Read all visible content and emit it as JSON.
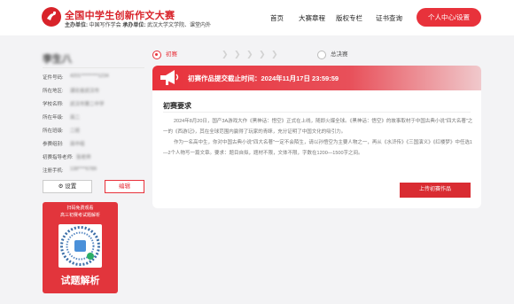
{
  "header": {
    "title": "全国中学生创新作文大赛",
    "sub_host_label": "主办单位:",
    "sub_host": "中国写作学会",
    "sub_org_label": "承办单位:",
    "sub_org": "武汉大学文学院、课堂内外",
    "nav": [
      "首页",
      "大赛章程",
      "版权专栏",
      "证书查询"
    ],
    "user_button": "个人中心/设置"
  },
  "profile": {
    "name": "李生八",
    "fields": [
      {
        "label": "证件号码:",
        "value": "4201*********1234"
      },
      {
        "label": "所在地区:",
        "value": "湖北省武汉市"
      },
      {
        "label": "学校名称:",
        "value": "武汉市第二中学"
      },
      {
        "label": "所在年级:",
        "value": "高二"
      },
      {
        "label": "所在班级:",
        "value": "二班"
      },
      {
        "label": "参赛组别:",
        "value": "高中组"
      },
      {
        "label": "初赛指导老师:",
        "value": "张老师"
      },
      {
        "label": "注册手机:",
        "value": "138****6789"
      }
    ],
    "settings_button": "⚙ 设置",
    "edit_button": "编辑"
  },
  "promo": {
    "line1": "扫码免费观看",
    "line2": "高三初赛考试题解析",
    "bottom": "试题解析"
  },
  "progress": {
    "step1": "初赛",
    "step2": "总决赛"
  },
  "main": {
    "deadline": "初赛作品提交截止时间：2024年11月17日 23:59:59",
    "req_title": "初赛要求",
    "para1": "2024年8月20日，国产3A游戏大作《黑神话：悟空》正式在上线，随即火爆全球。《黑神话：悟空》的故事取材于中国古典小说\"四大名著\"之一的《西游记》，其在全球范围内赢得了玩家的青睐，充分证明了中国文化的吸引力。",
    "para2": "作为一名高中生，你对中国古典小说\"四大名著\"一定不会陌生，请以孙悟空为主要人物之一，再从《水浒传》《三国演义》《红楼梦》中任选1—2个人物写一篇文章。要求：题目自拟，题材不限，文体不限，字数在1200—1500字之间。",
    "submit_button": "上传初赛作品"
  },
  "colors": {
    "accent": "#e8323b",
    "background": "#f3f3f5"
  }
}
